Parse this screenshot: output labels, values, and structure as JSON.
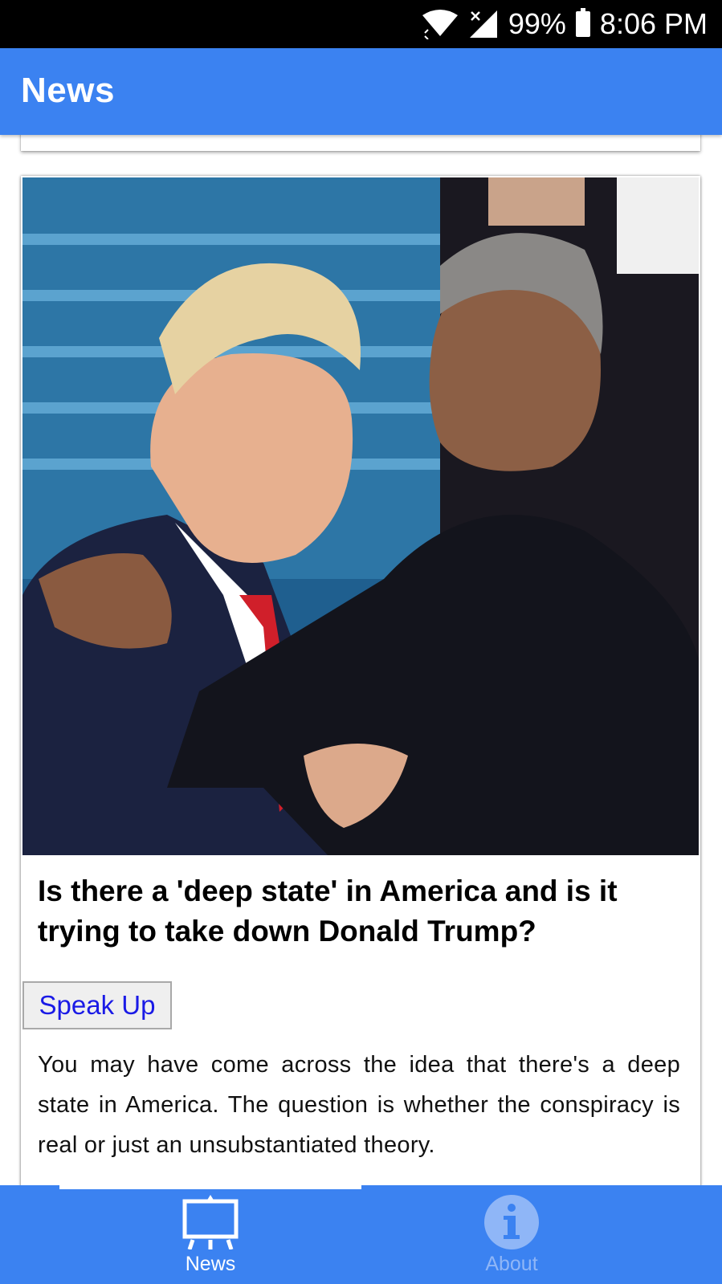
{
  "status_bar": {
    "battery": "99%",
    "time": "8:06 PM"
  },
  "app_bar": {
    "title": "News"
  },
  "article": {
    "headline": "Is there a 'deep state' in America and is it trying to take down Donald Trump?",
    "action_label": "Speak Up",
    "summary": "You may have come across the idea that there's a deep state in America. The question is whether the conspiracy is real or just an unsubstantiated theory."
  },
  "bottom_nav": {
    "items": [
      {
        "label": "News",
        "icon": "easel-icon",
        "active": true
      },
      {
        "label": "About",
        "icon": "info-icon",
        "active": false
      }
    ]
  },
  "colors": {
    "primary": "#3b82f1",
    "status_bar": "#000000",
    "link_text": "#1a1ae6",
    "inactive_nav": "#8fb6f7"
  }
}
